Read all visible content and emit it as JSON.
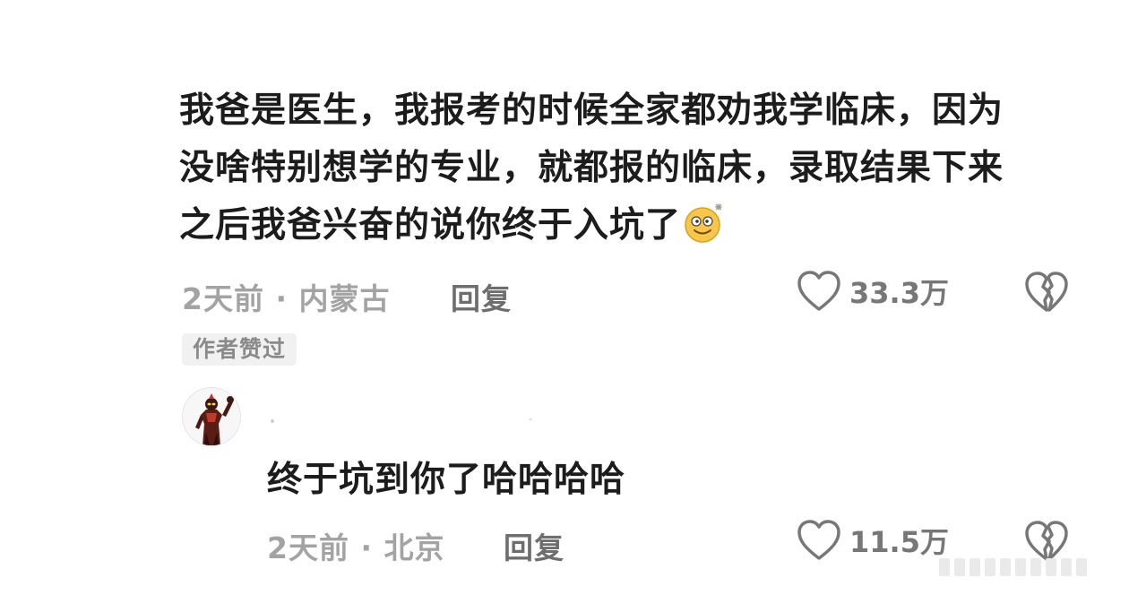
{
  "comment": {
    "text_lines": [
      "我爸是医生，我报考的时候全家都劝我学临床，因为",
      "没啥特别想学的专业，就都报的临床，录取结果下来",
      "之后我爸兴奋的说你终于入坑了"
    ],
    "emoji_icon": "dizzy-smile-emoji",
    "meta": "2天前 · 内蒙古",
    "reply_label": "回复",
    "like_count": "33.3万",
    "author_badge": "作者赞过"
  },
  "reply": {
    "avatar_icon": "ultraman-avatar",
    "text": "终于坑到你了哈哈哈哈",
    "meta": "2天前 · 北京",
    "reply_label": "回复",
    "like_count": "11.5万"
  },
  "icons": {
    "like": "heart-outline-icon",
    "dislike": "broken-heart-icon"
  },
  "colors": {
    "primary_text": "#1c1c1c",
    "meta_text": "#a3a3a3",
    "action_text": "#6e6e6e",
    "badge_bg": "#f1f1f1"
  }
}
